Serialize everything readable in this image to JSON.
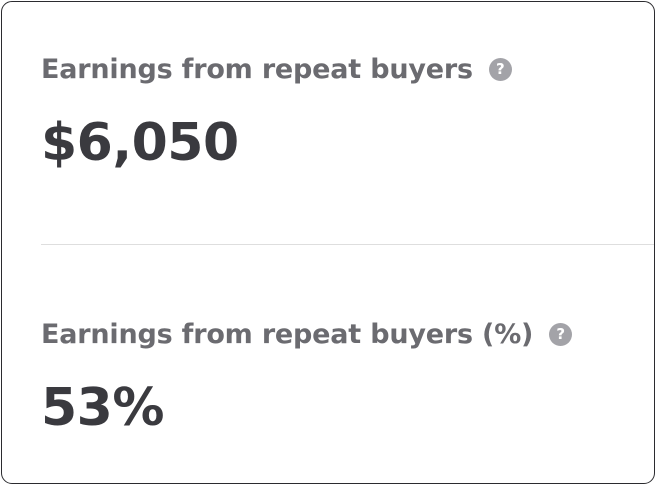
{
  "stats": [
    {
      "label": "Earnings from repeat buyers",
      "help_icon": "question-circle-icon",
      "help_glyph": "?",
      "value": "$6,050"
    },
    {
      "label": "Earnings from repeat buyers (%)",
      "help_icon": "question-circle-icon",
      "help_glyph": "?",
      "value": "53%"
    }
  ],
  "colors": {
    "label": "#6b6b70",
    "value": "#3a3a3f",
    "help_icon_bg": "#a3a3a8",
    "divider": "#dedede",
    "border": "#2b2b2f"
  }
}
